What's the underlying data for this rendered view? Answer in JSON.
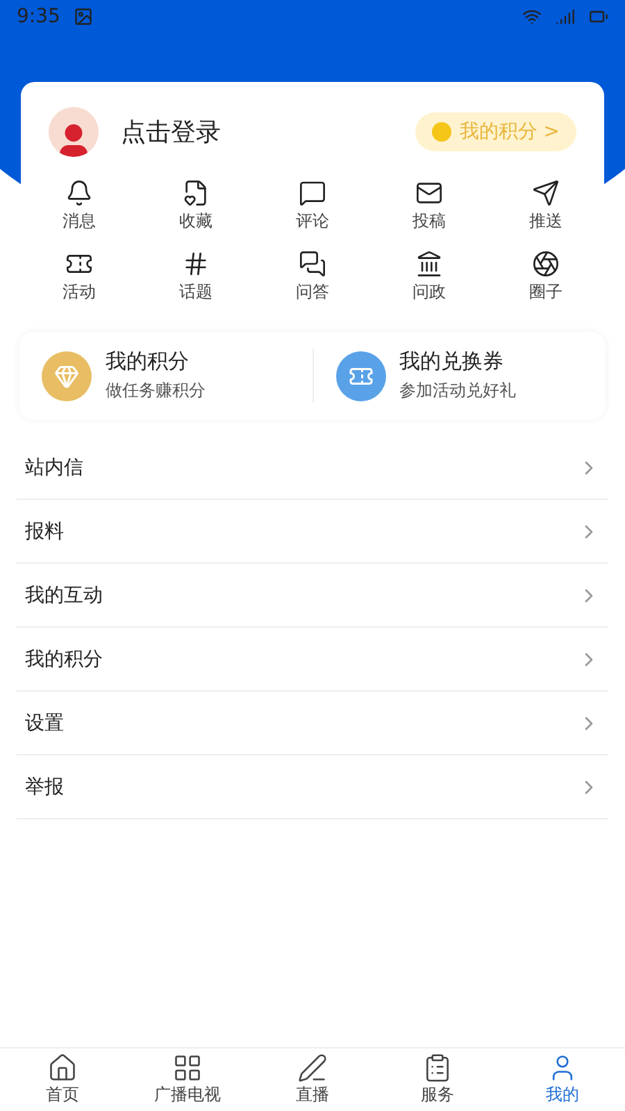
{
  "status_bar": {
    "time": "9:35"
  },
  "profile": {
    "login": "点击登录",
    "points_button": "我的积分 >"
  },
  "shortcuts": [
    {
      "kind": "bell",
      "label": "消息"
    },
    {
      "kind": "fav",
      "label": "收藏"
    },
    {
      "kind": "comment",
      "label": "评论"
    },
    {
      "kind": "mail",
      "label": "投稿"
    },
    {
      "kind": "send",
      "label": "推送"
    },
    {
      "kind": "ticket",
      "label": "活动"
    },
    {
      "kind": "hash",
      "label": "话题"
    },
    {
      "kind": "qa",
      "label": "问答"
    },
    {
      "kind": "gov",
      "label": "问政"
    },
    {
      "kind": "circle",
      "label": "圈子"
    }
  ],
  "cards": [
    {
      "kind": "points",
      "title": "我的积分",
      "subtitle": "做任务赚积分"
    },
    {
      "kind": "coupon",
      "title": "我的兑换券",
      "subtitle": "参加活动兑好礼"
    }
  ],
  "menu": [
    "站内信",
    "报料",
    "我的互动",
    "我的积分",
    "设置",
    "举报"
  ],
  "tabs": [
    {
      "kind": "home",
      "label": "首页",
      "selected": false
    },
    {
      "kind": "tv",
      "label": "广播电视",
      "selected": false
    },
    {
      "kind": "live",
      "label": "直播",
      "selected": false
    },
    {
      "kind": "service",
      "label": "服务",
      "selected": false
    },
    {
      "kind": "me",
      "label": "我的",
      "selected": true
    }
  ]
}
